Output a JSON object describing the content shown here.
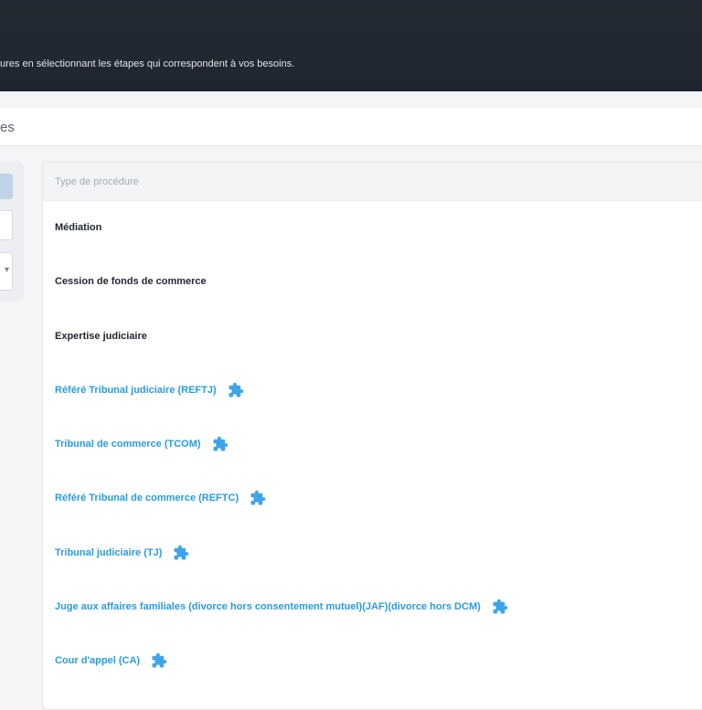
{
  "header": {
    "subtitle": "ures en sélectionnant les étapes qui correspondent à vos besoins."
  },
  "section": {
    "title": "es"
  },
  "table": {
    "column_header": "Type de procédure",
    "rows": [
      {
        "label": "Médiation",
        "has_plugin": false
      },
      {
        "label": "Cession de fonds de commerce",
        "has_plugin": false
      },
      {
        "label": "Expertise judiciaire",
        "has_plugin": false
      },
      {
        "label": "Référé Tribunal judiciaire (REFTJ)",
        "has_plugin": true
      },
      {
        "label": "Tribunal de commerce (TCOM)",
        "has_plugin": true
      },
      {
        "label": "Référé Tribunal de commerce (REFTC)",
        "has_plugin": true
      },
      {
        "label": "Tribunal judiciaire (TJ)",
        "has_plugin": true
      },
      {
        "label": "Juge aux affaires familiales (divorce hors consentement mutuel)(JAF)(divorce hors DCM)",
        "has_plugin": true
      },
      {
        "label": "Cour d'appel (CA)",
        "has_plugin": true
      }
    ]
  },
  "icons": {
    "plugin": "puzzle-icon",
    "select": "chevron-down-icon"
  },
  "colors": {
    "banner": "#232a33",
    "link": "#2a9be0",
    "plugin_icon": "#3ea6e8"
  }
}
